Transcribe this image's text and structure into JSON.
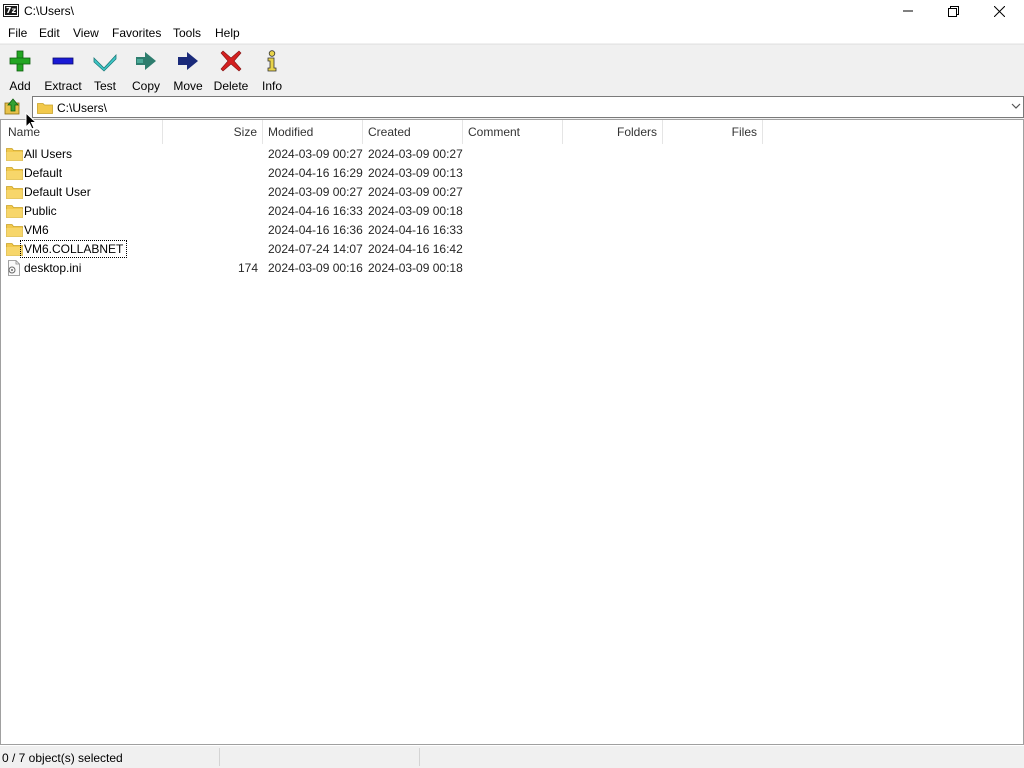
{
  "window": {
    "title": "C:\\Users\\",
    "app_icon_text": "7z"
  },
  "menu": {
    "items": [
      "File",
      "Edit",
      "View",
      "Favorites",
      "Tools",
      "Help"
    ]
  },
  "toolbar": {
    "buttons": [
      {
        "label": "Add",
        "icon": "plus-icon"
      },
      {
        "label": "Extract",
        "icon": "minus-icon"
      },
      {
        "label": "Test",
        "icon": "checkmark-icon"
      },
      {
        "label": "Copy",
        "icon": "copy-arrow-icon"
      },
      {
        "label": "Move",
        "icon": "move-arrow-icon"
      },
      {
        "label": "Delete",
        "icon": "delete-x-icon"
      },
      {
        "label": "Info",
        "icon": "info-icon"
      }
    ]
  },
  "address": {
    "path": "C:\\Users\\"
  },
  "columns": {
    "name": "Name",
    "size": "Size",
    "modified": "Modified",
    "created": "Created",
    "comment": "Comment",
    "folders": "Folders",
    "files": "Files"
  },
  "rows": [
    {
      "name": "All Users",
      "size": "",
      "modified": "2024-03-09 00:27",
      "created": "2024-03-09 00:27",
      "type": "folder"
    },
    {
      "name": "Default",
      "size": "",
      "modified": "2024-04-16 16:29",
      "created": "2024-03-09 00:13",
      "type": "folder"
    },
    {
      "name": "Default User",
      "size": "",
      "modified": "2024-03-09 00:27",
      "created": "2024-03-09 00:27",
      "type": "folder"
    },
    {
      "name": "Public",
      "size": "",
      "modified": "2024-04-16 16:33",
      "created": "2024-03-09 00:18",
      "type": "folder"
    },
    {
      "name": "VM6",
      "size": "",
      "modified": "2024-04-16 16:36",
      "created": "2024-04-16 16:33",
      "type": "folder"
    },
    {
      "name": "VM6.COLLABNET",
      "size": "",
      "modified": "2024-07-24 14:07",
      "created": "2024-04-16 16:42",
      "type": "folder",
      "focused": true
    },
    {
      "name": "desktop.ini",
      "size": "174",
      "modified": "2024-03-09 00:16",
      "created": "2024-03-09 00:18",
      "type": "file"
    }
  ],
  "status": {
    "text": "0 / 7 object(s) selected"
  },
  "colors": {
    "toolbar_bg": "#f0f0f0",
    "folder_yellow": "#f2c94c",
    "add_green": "#22a622",
    "extract_blue": "#1a1ad6",
    "test_cyan": "#3fc7c7",
    "copy_teal": "#2e7d6e",
    "move_navy": "#1a2a7a",
    "delete_red": "#d42020"
  }
}
